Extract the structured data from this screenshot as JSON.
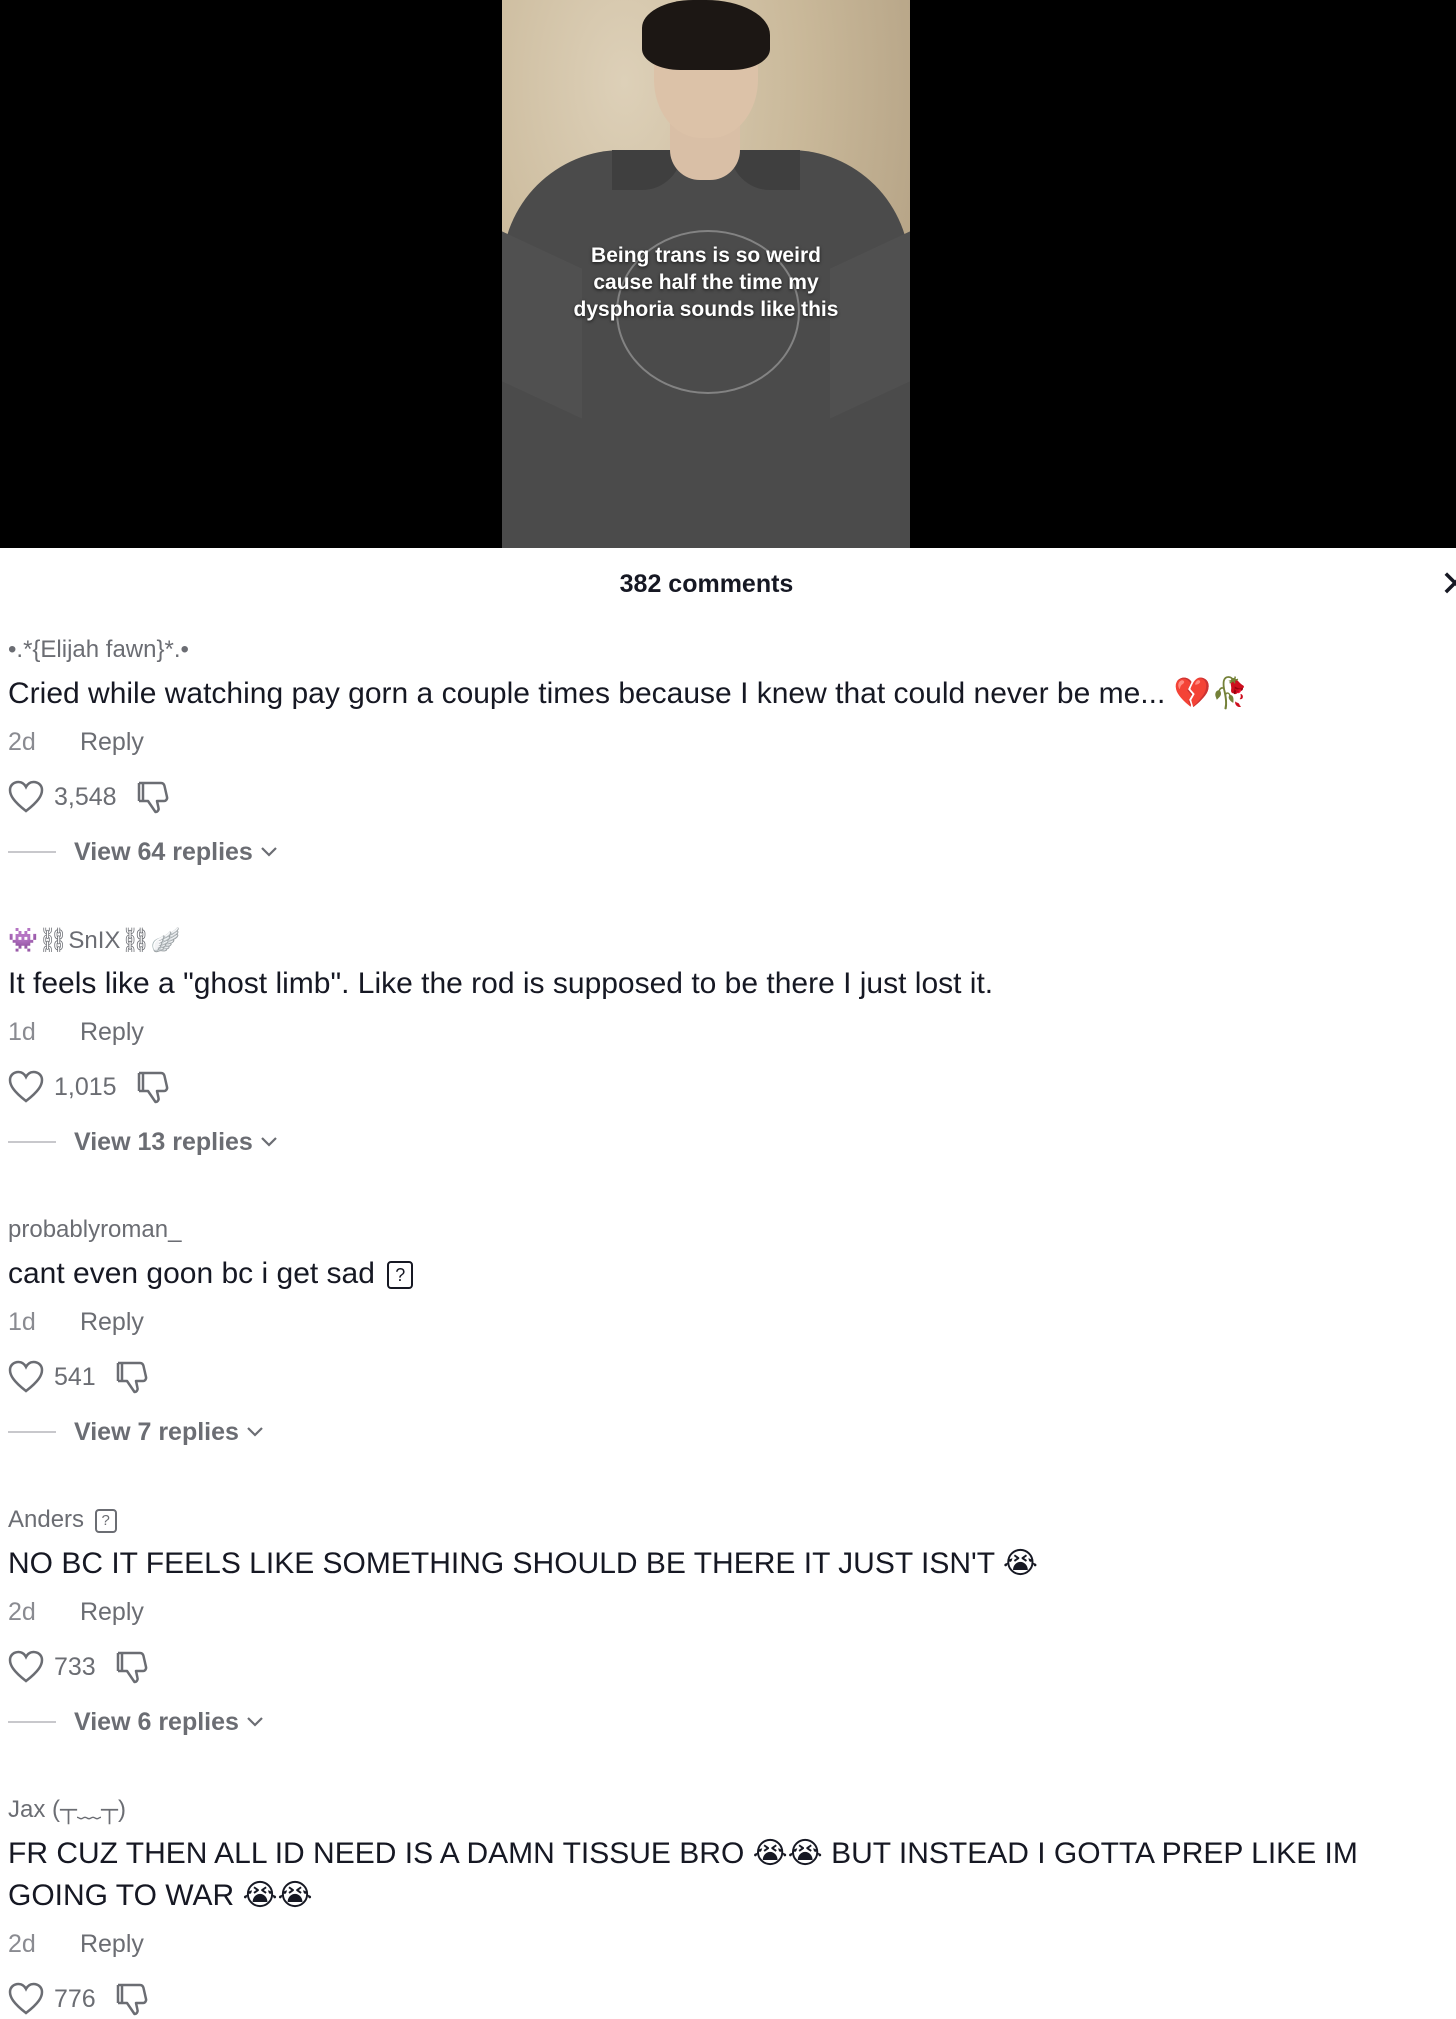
{
  "video": {
    "overlay_text": "Being trans is so weird cause half the time my dysphoria sounds like this"
  },
  "header": {
    "comment_count": "382 comments",
    "close_icon": "close-icon"
  },
  "comments": [
    {
      "username": "•.*{Elijah fawn}*.•",
      "text": "Cried while watching pay gorn a couple times because I knew that could never be me...",
      "text_emoji": "💔🥀",
      "time": "2d",
      "reply_label": "Reply",
      "likes": "3,548",
      "view_replies": "View 64 replies"
    },
    {
      "username_emoji": "👾⛓",
      "username": "SnIX",
      "username_suffix": "⛓🪽",
      "text": "It feels like a \"ghost limb\". Like the rod is supposed to be there I just lost it.",
      "time": "1d",
      "reply_label": "Reply",
      "likes": "1,015",
      "view_replies": "View 13 replies"
    },
    {
      "username": "probablyroman_",
      "text": "cant even goon bc i get sad",
      "time": "1d",
      "reply_label": "Reply",
      "likes": "541",
      "view_replies": "View 7 replies"
    },
    {
      "username": "Anders",
      "text": "NO BC IT FEELS LIKE SOMETHING SHOULD BE THERE IT JUST ISN'T",
      "text_emoji": "😭",
      "time": "2d",
      "reply_label": "Reply",
      "likes": "733",
      "view_replies": "View 6 replies"
    },
    {
      "username": "Jax (┬﹏┬)",
      "text_part1": "FR CUZ THEN ALL ID NEED IS A DAMN TISSUE BRO",
      "emoji_1": "😭😭",
      "text_part2": "BUT INSTEAD I GOTTA PREP LIKE IM GOING TO WAR",
      "emoji_2": "😭😭",
      "time": "2d",
      "reply_label": "Reply",
      "likes": "776"
    }
  ],
  "colors": {
    "text_primary": "#161823",
    "text_secondary": "#6b6d73",
    "background": "#ffffff"
  }
}
